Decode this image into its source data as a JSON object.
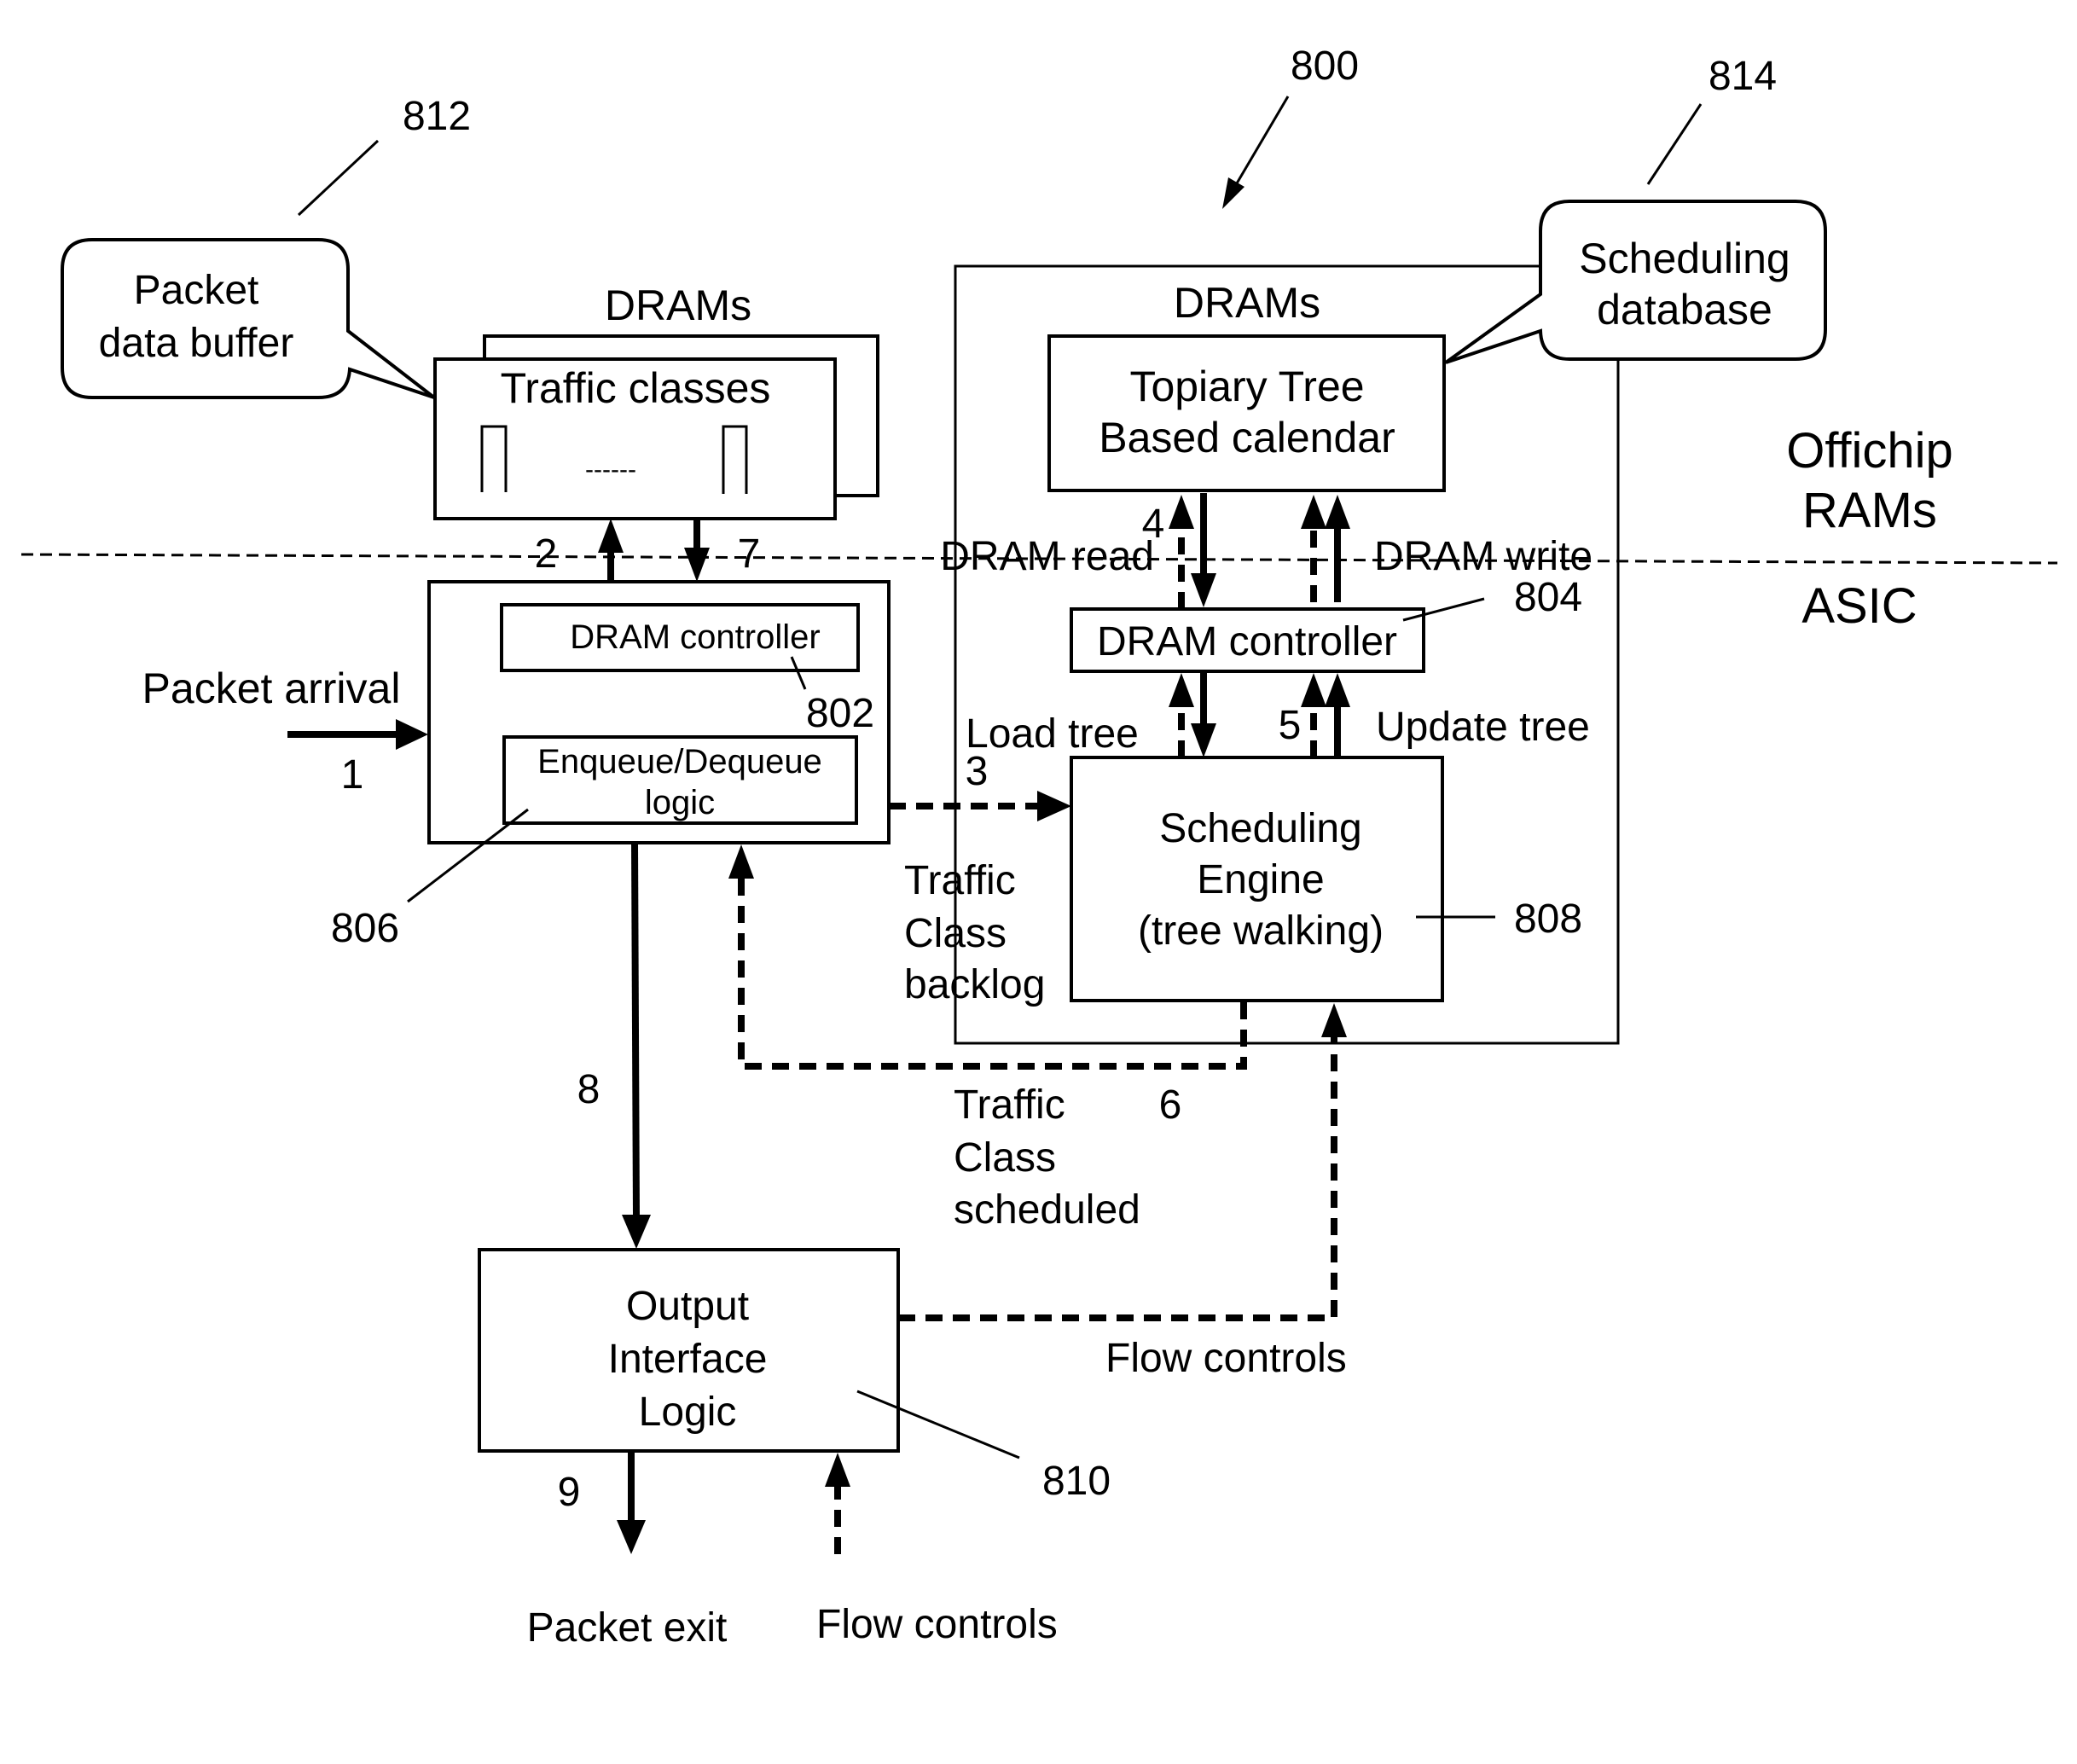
{
  "figure": {
    "ref_system": "800",
    "ref_packet_buffer": "812",
    "ref_scheduling_db": "814",
    "ref_dram_ctrl_left": "802",
    "ref_dram_ctrl_right": "804",
    "ref_enqueue": "806",
    "ref_engine": "808",
    "ref_output": "810"
  },
  "regions": {
    "offchip_line1": "Offichip",
    "offchip_line2": "RAMs",
    "asic": "ASIC"
  },
  "callouts": {
    "packet_buffer": [
      "Packet",
      "data buffer"
    ],
    "scheduling_db": [
      "Scheduling",
      "database"
    ]
  },
  "blocks": {
    "left_drams_label": "DRAMs",
    "traffic_classes": "Traffic classes",
    "traffic_classes_ellipsis": "------",
    "right_drams_label": "DRAMs",
    "topiary": [
      "Topiary Tree",
      "Based calendar"
    ],
    "dram_ctrl_left": "DRAM controller",
    "enqueue": [
      "Enqueue/Dequeue",
      "logic"
    ],
    "dram_ctrl_right": "DRAM controller",
    "engine": [
      "Scheduling",
      "Engine",
      "(tree walking)"
    ],
    "output": [
      "Output",
      "Interface",
      "Logic"
    ]
  },
  "flows": {
    "packet_arrival": "Packet arrival",
    "step1": "1",
    "step2": "2",
    "step3": "3",
    "step4": "4",
    "step5": "5",
    "step6": "6",
    "step7": "7",
    "step8": "8",
    "step9": "9",
    "dram_read": "DRAM read",
    "dram_write": "DRAM write",
    "load_tree": "Load tree",
    "update_tree": "Update tree",
    "backlog": [
      "Traffic",
      "Class",
      "backlog"
    ],
    "scheduled": [
      "Traffic",
      "Class",
      "scheduled"
    ],
    "flow_controls_right": "Flow controls",
    "flow_controls_bottom": "Flow controls",
    "packet_exit": "Packet exit"
  }
}
